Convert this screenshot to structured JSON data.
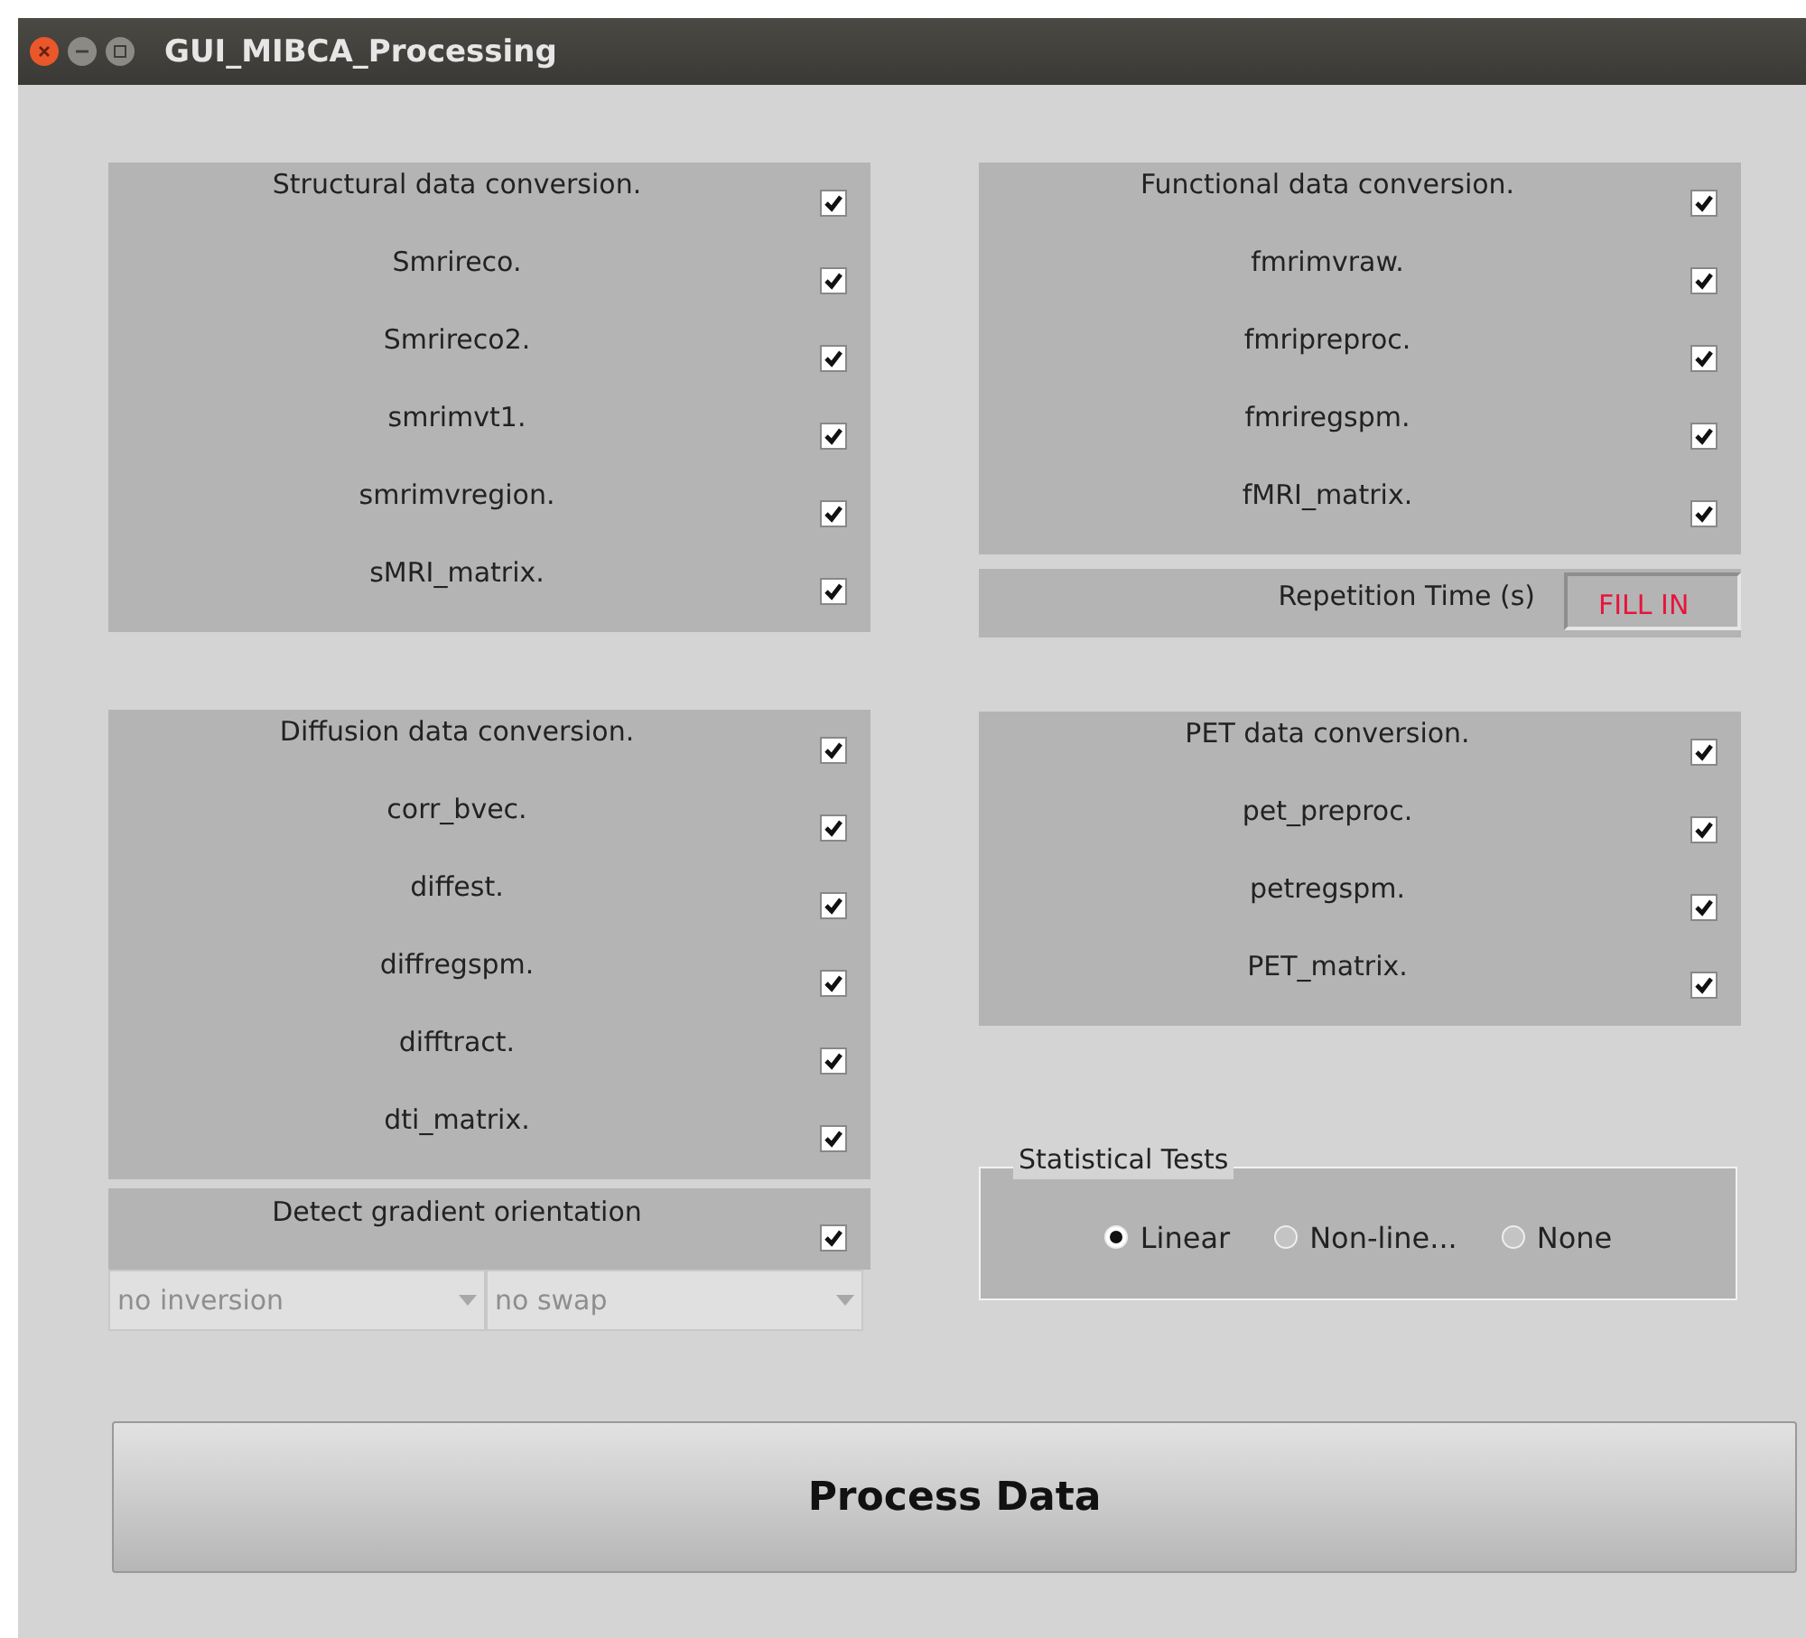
{
  "window": {
    "title": "GUI_MIBCA_Processing"
  },
  "structural": {
    "rows": [
      {
        "label": "Structural data conversion.",
        "checked": true
      },
      {
        "label": "Smrireco.",
        "checked": true
      },
      {
        "label": "Smrireco2.",
        "checked": true
      },
      {
        "label": "smrimvt1.",
        "checked": true
      },
      {
        "label": "smrimvregion.",
        "checked": true
      },
      {
        "label": "sMRI_matrix.",
        "checked": true
      }
    ]
  },
  "diffusion": {
    "rows": [
      {
        "label": "Diffusion data conversion.",
        "checked": true
      },
      {
        "label": "corr_bvec.",
        "checked": true
      },
      {
        "label": "diffest.",
        "checked": true
      },
      {
        "label": "diffregspm.",
        "checked": true
      },
      {
        "label": "difftract.",
        "checked": true
      },
      {
        "label": "dti_matrix.",
        "checked": true
      }
    ]
  },
  "gradient": {
    "label": "Detect gradient orientation",
    "checked": true,
    "dropdowns": [
      {
        "value": "no inversion",
        "disabled": true
      },
      {
        "value": "no swap",
        "disabled": true
      }
    ]
  },
  "functional": {
    "rows": [
      {
        "label": "Functional data conversion.",
        "checked": true
      },
      {
        "label": "fmrimvraw.",
        "checked": true
      },
      {
        "label": "fmripreproc.",
        "checked": true
      },
      {
        "label": "fmriregspm.",
        "checked": true
      },
      {
        "label": "fMRI_matrix.",
        "checked": true
      }
    ]
  },
  "repetition": {
    "label": "Repetition Time (s)",
    "value": "FILL IN"
  },
  "pet": {
    "rows": [
      {
        "label": "PET data conversion.",
        "checked": true
      },
      {
        "label": "pet_preproc.",
        "checked": true
      },
      {
        "label": "petregspm.",
        "checked": true
      },
      {
        "label": "PET_matrix.",
        "checked": true
      }
    ]
  },
  "statistical_tests": {
    "title": "Statistical Tests",
    "options": [
      {
        "label": "Linear",
        "selected": true
      },
      {
        "label": "Non-line...",
        "selected": false
      },
      {
        "label": "None",
        "selected": false
      }
    ]
  },
  "process_button": {
    "label": "Process Data"
  }
}
